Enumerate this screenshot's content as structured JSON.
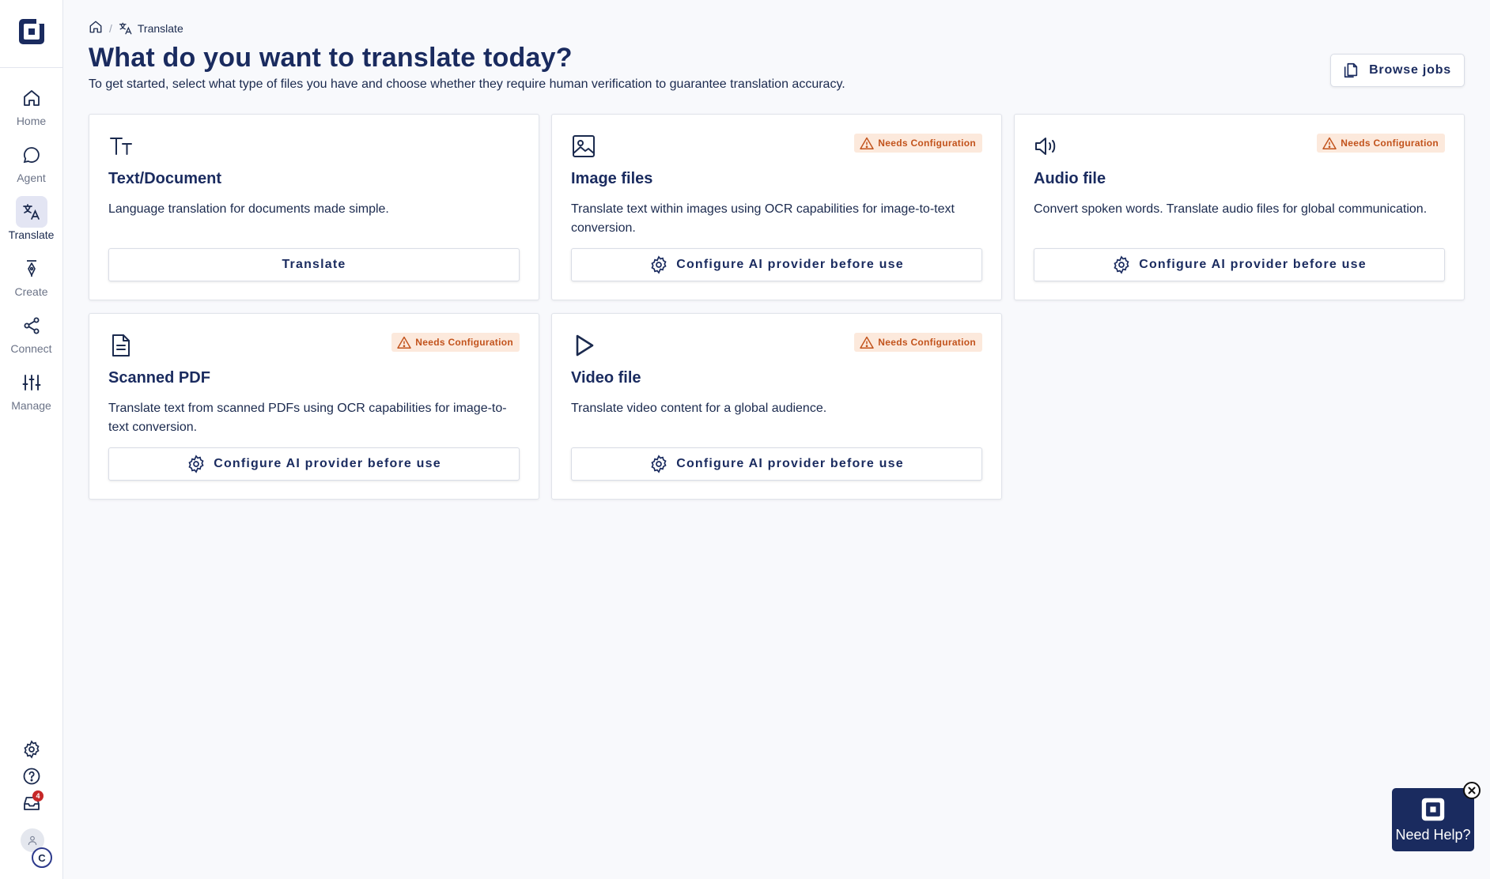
{
  "sidebar": {
    "items": [
      {
        "label": "Home",
        "icon": "home-icon"
      },
      {
        "label": "Agent",
        "icon": "chat-bubble-icon"
      },
      {
        "label": "Translate",
        "icon": "translate-icon"
      },
      {
        "label": "Create",
        "icon": "pen-nib-icon"
      },
      {
        "label": "Connect",
        "icon": "share-nodes-icon"
      },
      {
        "label": "Manage",
        "icon": "sliders-icon"
      }
    ],
    "active": "Translate",
    "inbox_badge": "4",
    "org_initial": "C"
  },
  "breadcrumb": {
    "separator": "/",
    "current": "Translate"
  },
  "header": {
    "title": "What do you want to translate today?",
    "subtitle": "To get started, select what type of files you have and choose whether they require human verification to guarantee translation accuracy.",
    "browse_button": "Browse jobs"
  },
  "cards": [
    {
      "title": "Text/Document",
      "description": "Language translation for documents made simple.",
      "button": "Translate",
      "badge": null,
      "icon": "text-size-icon"
    },
    {
      "title": "Image files",
      "description": "Translate text within images using OCR capabilities for image-to-text conversion.",
      "button": "Configure AI provider before use",
      "badge": "Needs Configuration",
      "icon": "image-icon"
    },
    {
      "title": "Audio file",
      "description": "Convert spoken words. Translate audio files for global communication.",
      "button": "Configure AI provider before use",
      "badge": "Needs Configuration",
      "icon": "speaker-icon"
    },
    {
      "title": "Scanned PDF",
      "description": "Translate text from scanned PDFs using OCR capabilities for image-to-text conversion.",
      "button": "Configure AI provider before use",
      "badge": "Needs Configuration",
      "icon": "document-icon"
    },
    {
      "title": "Video file",
      "description": "Translate video content for a global audience.",
      "button": "Configure AI provider before use",
      "badge": "Needs Configuration",
      "icon": "play-icon"
    }
  ],
  "help_widget": {
    "label": "Need Help?"
  },
  "colors": {
    "primary": "#1a2b5f",
    "warning_bg": "#fce9dc",
    "warning_text": "#c2531c",
    "active_nav_bg": "#e3e5f3",
    "badge_red": "#c62828"
  }
}
